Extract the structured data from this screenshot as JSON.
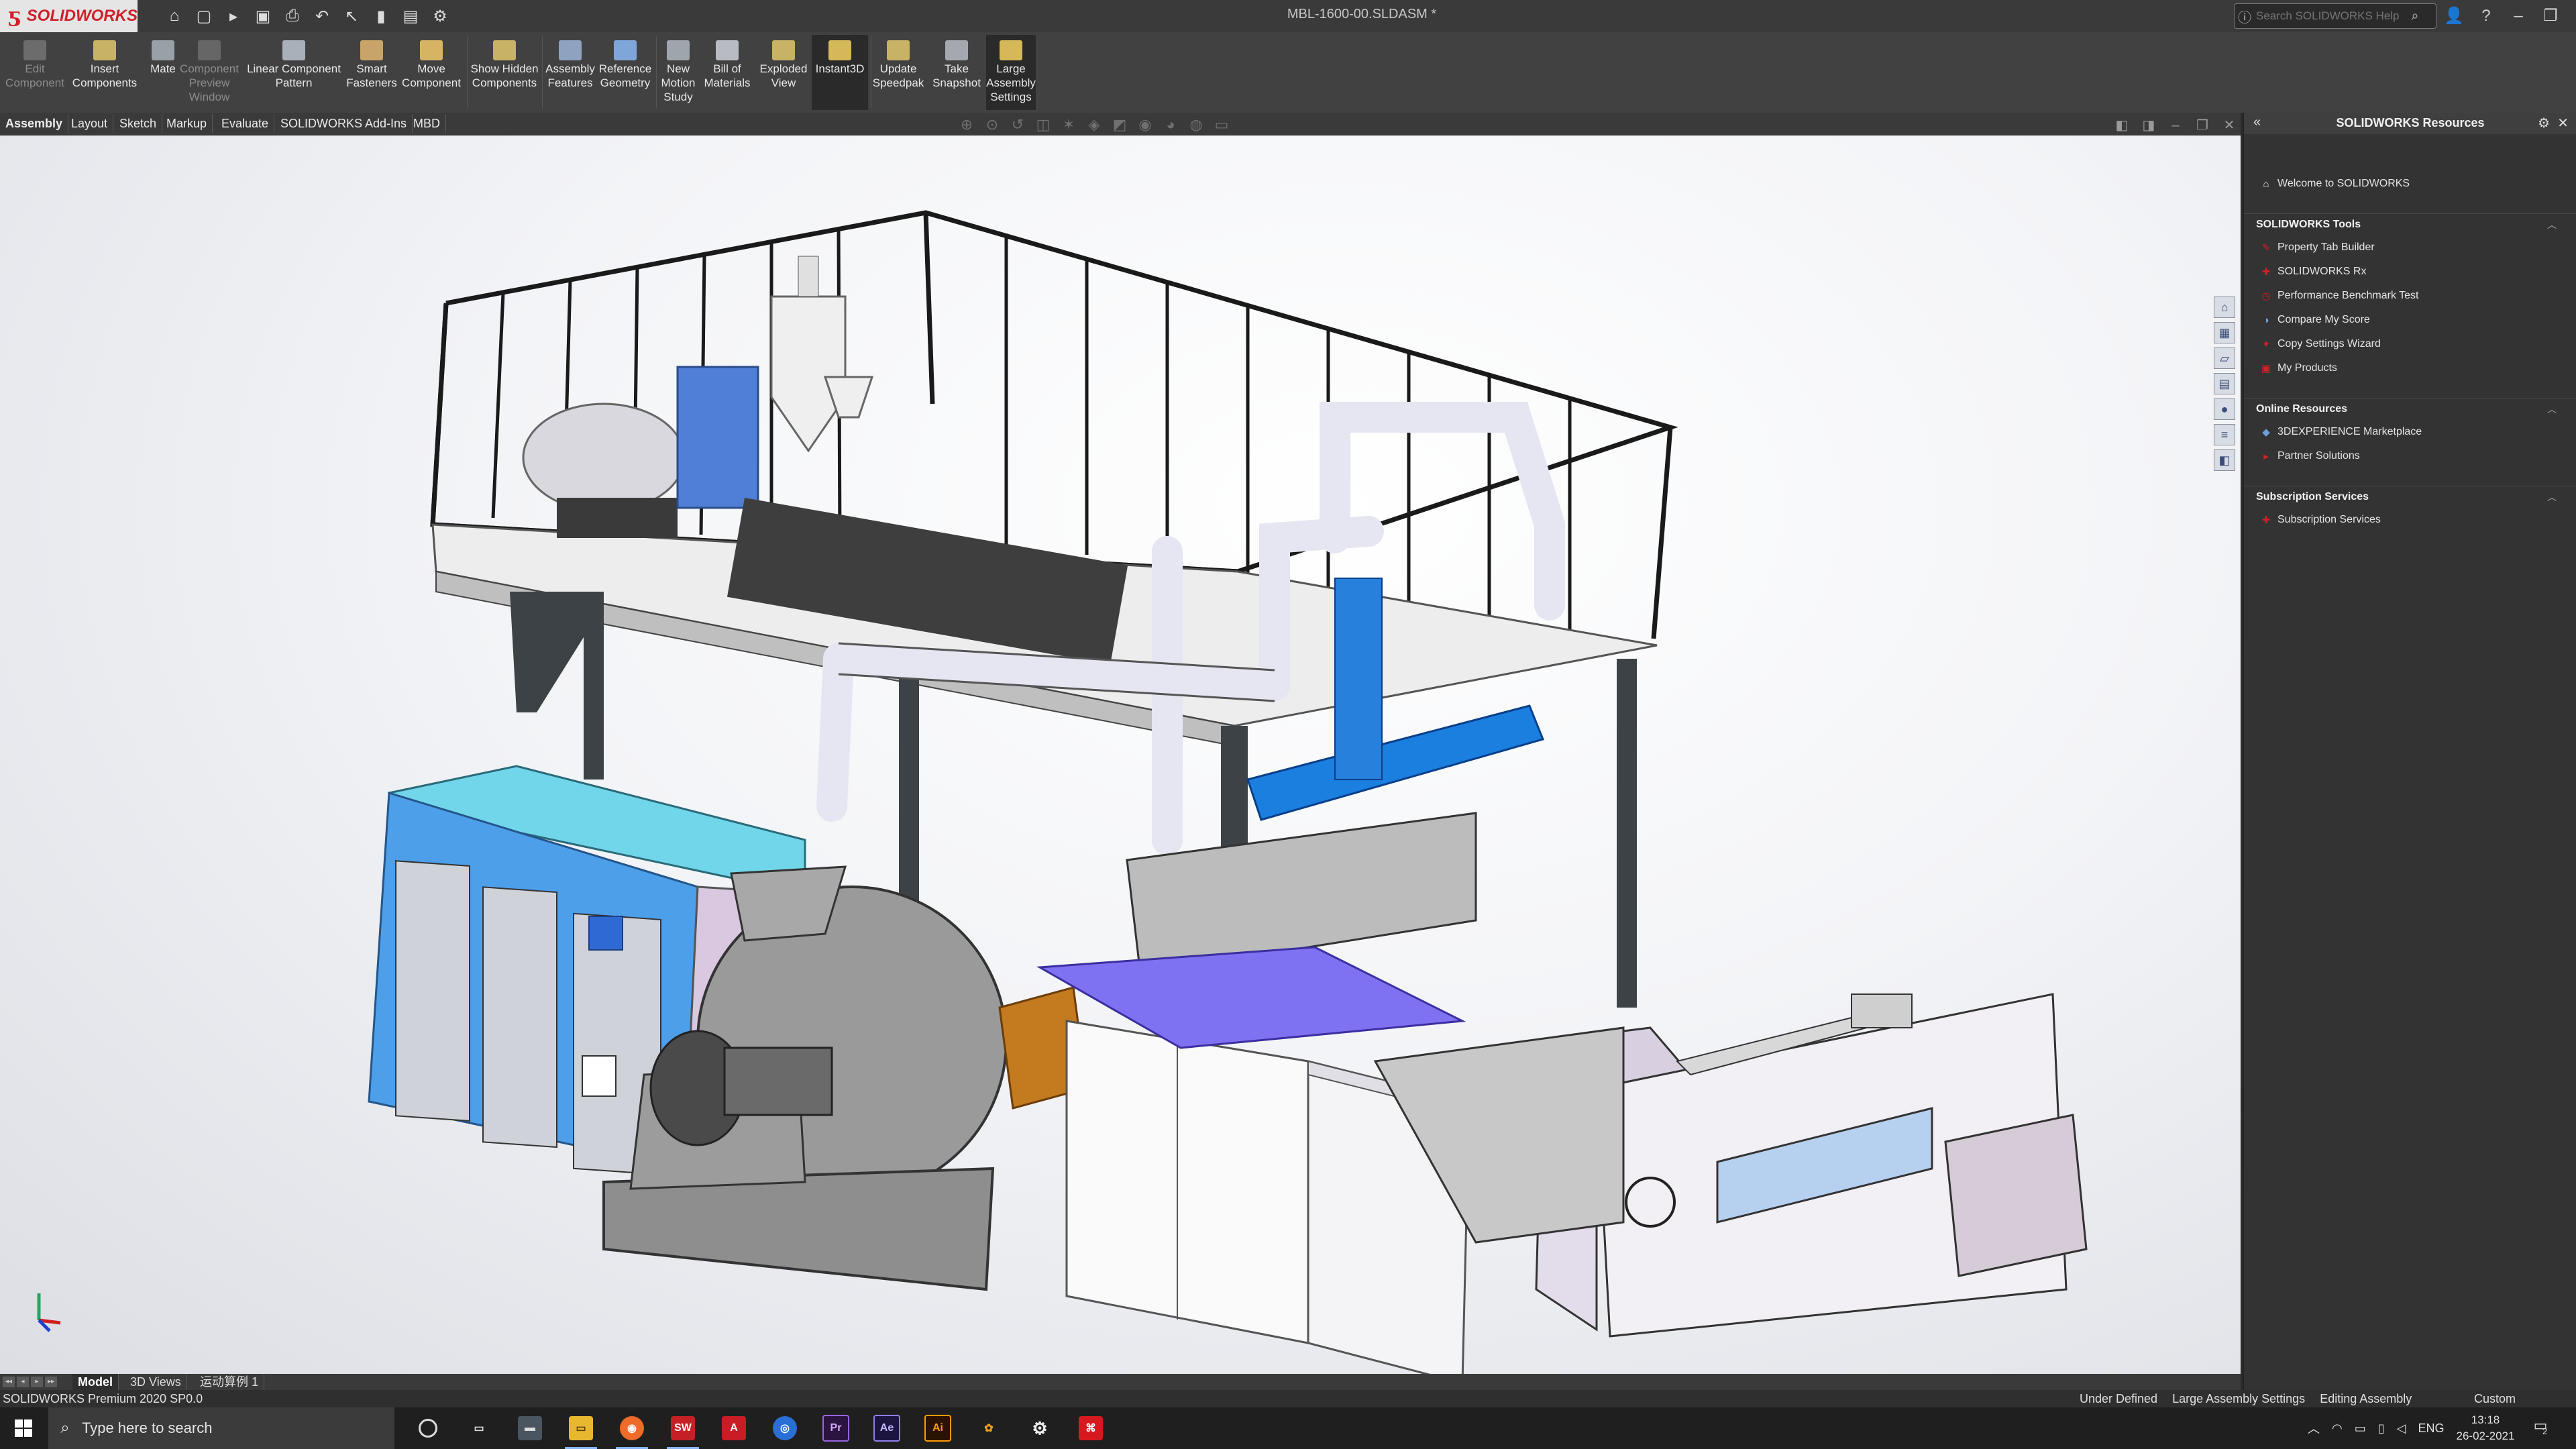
{
  "app": {
    "brand": "SOLIDWORKS",
    "document_title": "MBL-1600-00.SLDASM *",
    "help_search_placeholder": "Search SOLIDWORKS Help",
    "brand_color": "#d0202a"
  },
  "commands": [
    {
      "label": "Edit Component",
      "enabled": false,
      "icon": "edit-component-icon"
    },
    {
      "label": "Insert Components",
      "enabled": true,
      "icon": "insert-components-icon"
    },
    {
      "label": "Mate",
      "enabled": true,
      "icon": "mate-icon"
    },
    {
      "label": "Component Preview Window",
      "enabled": false,
      "icon": "preview-window-icon"
    },
    {
      "label": "Linear Component Pattern",
      "enabled": true,
      "icon": "linear-pattern-icon"
    },
    {
      "label": "Smart Fasteners",
      "enabled": true,
      "icon": "smart-fasteners-icon"
    },
    {
      "label": "Move Component",
      "enabled": true,
      "icon": "move-component-icon"
    },
    {
      "label": "Show Hidden Components",
      "enabled": true,
      "icon": "show-hidden-icon"
    },
    {
      "label": "Assembly Features",
      "enabled": true,
      "icon": "assembly-features-icon"
    },
    {
      "label": "Reference Geometry",
      "enabled": true,
      "icon": "reference-geometry-icon"
    },
    {
      "label": "New Motion Study",
      "enabled": true,
      "icon": "motion-study-icon"
    },
    {
      "label": "Bill of Materials",
      "enabled": true,
      "icon": "bom-icon"
    },
    {
      "label": "Exploded View",
      "enabled": true,
      "icon": "exploded-view-icon"
    },
    {
      "label": "Instant3D",
      "enabled": true,
      "active": true,
      "icon": "instant3d-icon"
    },
    {
      "label": "Update Speedpak",
      "enabled": true,
      "icon": "speedpak-icon"
    },
    {
      "label": "Take Snapshot",
      "enabled": true,
      "icon": "snapshot-icon"
    },
    {
      "label": "Large Assembly Settings",
      "enabled": true,
      "active": true,
      "icon": "large-assembly-icon"
    }
  ],
  "tabs": [
    "Assembly",
    "Layout",
    "Sketch",
    "Markup",
    "Evaluate",
    "SOLIDWORKS Add-Ins",
    "MBD"
  ],
  "active_tab": "Assembly",
  "resources_panel": {
    "title": "SOLIDWORKS Resources",
    "welcome": "Welcome to SOLIDWORKS",
    "sections": [
      {
        "title": "SOLIDWORKS Tools",
        "items": [
          "Property Tab Builder",
          "SOLIDWORKS Rx",
          "Performance Benchmark Test",
          "Compare My Score",
          "Copy Settings Wizard",
          "My Products"
        ]
      },
      {
        "title": "Online Resources",
        "items": [
          "3DEXPERIENCE Marketplace",
          "Partner Solutions"
        ]
      },
      {
        "title": "Subscription Services",
        "items": [
          "Subscription Services"
        ]
      }
    ]
  },
  "bottom_tabs": [
    "Model",
    "3D Views",
    "运动算例 1"
  ],
  "status": {
    "product": "SOLIDWORKS Premium 2020 SP0.0",
    "definition": "Under Defined",
    "mode": "Large Assembly Settings",
    "editing": "Editing Assembly",
    "units": "Custom"
  },
  "taskbar": {
    "search_placeholder": "Type here to search",
    "language": "ENG",
    "time": "13:18",
    "date": "26-02-2021",
    "notifications": "2"
  }
}
